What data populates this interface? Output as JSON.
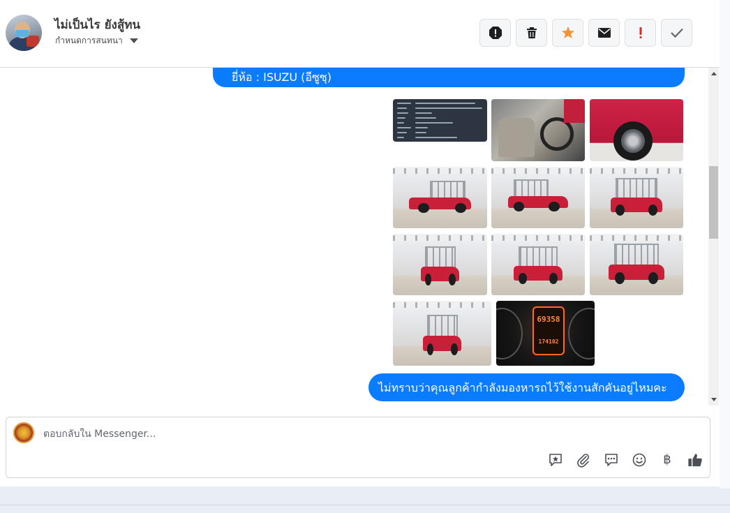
{
  "header": {
    "contact_name": "ไม่เป็นไร ยังสู้ทน",
    "conversation_label": "กำหนดการสนทนา",
    "actions": [
      {
        "id": "spam",
        "icon": "alert-octagon-icon",
        "color": "#1c1e21"
      },
      {
        "id": "delete",
        "icon": "trash-icon",
        "color": "#1c1e21"
      },
      {
        "id": "star",
        "icon": "star-icon",
        "color": "#f7923b"
      },
      {
        "id": "unread",
        "icon": "envelope-icon",
        "color": "#1c1e21"
      },
      {
        "id": "important",
        "icon": "exclamation-icon",
        "color": "#e0281f"
      },
      {
        "id": "done",
        "icon": "checkmark-icon",
        "color": "#606770"
      }
    ]
  },
  "thread": {
    "messages": [
      {
        "type": "text",
        "text": "ยี่ห้อ : ISUZU (อีซูซุ)"
      },
      {
        "type": "photos",
        "count": 11,
        "subjects": [
          "spec-sheet",
          "interior",
          "wheel",
          "truck-side",
          "truck-side",
          "truck-rear-quarter",
          "truck-rear",
          "truck-rear-quarter",
          "truck-front-quarter",
          "truck-front",
          "odometer"
        ]
      },
      {
        "type": "text",
        "text": "ไม่ทราบว่าคุณลูกค้ากำลังมองหารถไว้ใช้งานสักคันอยู่ไหมคะ"
      }
    ],
    "odometer_reading": "69358",
    "odometer_trip": "174102",
    "accent_color": "#0a7cff"
  },
  "composer": {
    "placeholder": "ตอบกลับใน Messenger...",
    "tools": [
      "saved-reply-icon",
      "paperclip-icon",
      "speech-bubble-icon",
      "emoji-icon",
      "baht-icon",
      "thumbs-up-icon"
    ],
    "currency_symbol": "฿"
  }
}
